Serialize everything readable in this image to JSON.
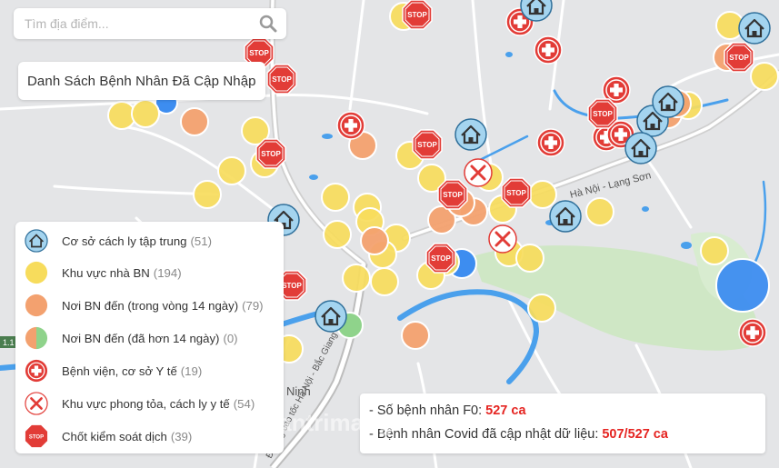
{
  "search": {
    "placeholder": "Tìm địa điểm..."
  },
  "list_button": {
    "label": "Danh Sách Bệnh Nhân Đã Cập Nhập"
  },
  "legend": {
    "items": [
      {
        "label": "Cơ sở cách ly tập trung",
        "count": "(51)",
        "icon": "house-icon"
      },
      {
        "label": "Khu vực nhà BN",
        "count": "(194)",
        "icon": "yellow-circle-icon"
      },
      {
        "label": "Nơi BN đến (trong vòng 14 ngày)",
        "count": "(79)",
        "icon": "orange-circle-icon"
      },
      {
        "label": "Nơi BN đến (đã hơn 14 ngày)",
        "count": "(0)",
        "icon": "split-circle-icon"
      },
      {
        "label": "Bệnh viện, cơ sở Y tế",
        "count": "(19)",
        "icon": "hospital-cross-icon"
      },
      {
        "label": "Khu vực phong tỏa, cách ly y tế",
        "count": "(54)",
        "icon": "x-circle-icon"
      },
      {
        "label": "Chốt kiểm soát dịch",
        "count": "(39)",
        "icon": "stop-sign-icon"
      }
    ]
  },
  "stats": {
    "f0_label": "- Số bệnh nhân F0:",
    "f0_value": "527 ca",
    "updated_label": "- Bệnh nhân Covid đã cập nhật dữ liệu:",
    "updated_value": "507/527 ca"
  },
  "map_labels": {
    "road_lang_son": "Hà Nội - Lạng Sơn",
    "road_ha_noi_bac_giang": "Đường cao tốc Hà Nội - Bắc Giang",
    "ninh": "Ninh",
    "bac_giang": "Bắc Giang",
    "road_badge": "1.1",
    "watermark": "Quantrimang"
  },
  "colors": {
    "yellow": "#f7dc5c",
    "orange": "#f3a16f",
    "red": "#e23c37",
    "blue": "#3d8df0",
    "house_bg": "#9fd0ec",
    "price_red": "#e52421"
  }
}
